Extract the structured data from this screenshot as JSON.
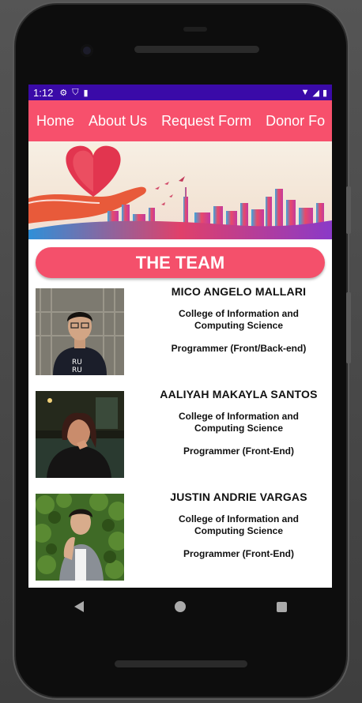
{
  "status_bar": {
    "time": "1:12",
    "icons": [
      "settings-icon",
      "shield-icon",
      "sd-card-icon",
      "wifi-icon",
      "signal-icon",
      "battery-icon"
    ]
  },
  "nav": {
    "items": [
      "Home",
      "About Us",
      "Request Form",
      "Donor Fo"
    ]
  },
  "section_title": "THE TEAM",
  "members": [
    {
      "name": "MICO ANGELO MALLARI",
      "college_line1": "College of Information and",
      "college_line2": "Computing Science",
      "role": "Programmer (Front/Back-end)"
    },
    {
      "name": "AALIYAH MAKAYLA SANTOS",
      "college_line1": "College of Information and",
      "college_line2": "Computing Science",
      "role": "Programmer (Front-End)"
    },
    {
      "name": "JUSTIN ANDRIE VARGAS",
      "college_line1": "College of Information and",
      "college_line2": "Computing Science",
      "role": "Programmer (Front-End)"
    }
  ],
  "colors": {
    "status_bar": "#3a0aa8",
    "nav_bar": "#f7506c",
    "accent": "#f4506b"
  }
}
